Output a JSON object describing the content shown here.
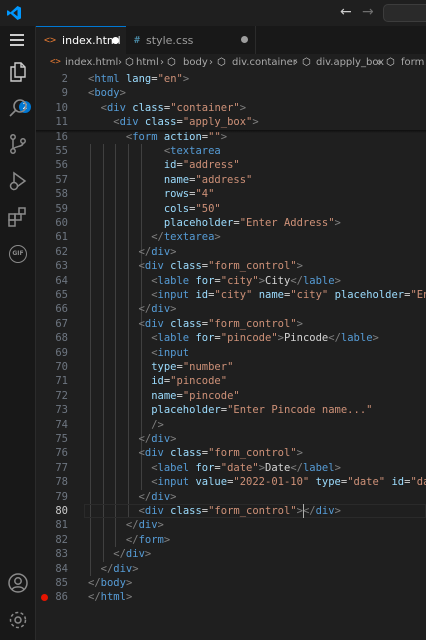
{
  "titlebar": {
    "back_icon": "arrow-left-icon",
    "forward_icon": "arrow-right-icon"
  },
  "activity_bar": {
    "items": [
      {
        "name": "explorer",
        "icon": "files-icon",
        "badge": "2"
      },
      {
        "name": "search",
        "icon": "search-icon"
      },
      {
        "name": "source-control",
        "icon": "source-control-icon"
      },
      {
        "name": "run-debug",
        "icon": "run-debug-icon"
      },
      {
        "name": "extensions",
        "icon": "extensions-icon"
      },
      {
        "name": "gif",
        "icon": "gif-icon",
        "label": "GIF"
      },
      {
        "name": "accounts",
        "icon": "account-icon"
      },
      {
        "name": "manage",
        "icon": "gear-icon"
      }
    ]
  },
  "tabs": [
    {
      "label": "index.html",
      "icon_text": "<>",
      "icon_color": "#e37933",
      "active": true,
      "modified": true
    },
    {
      "label": "style.css",
      "icon_text": "#",
      "icon_color": "#519aba",
      "active": false,
      "modified": true
    }
  ],
  "breadcrumbs": [
    "index.html",
    "html",
    "body",
    "div.container",
    "div.apply_box",
    "form"
  ],
  "colors": {
    "tag": "#569cd6",
    "attribute": "#9cdcfe",
    "string": "#ce9178",
    "punctuation": "#808080",
    "text": "#d4d4d4",
    "accent": "#0078d4",
    "breakpoint": "#e51400"
  },
  "editor": {
    "current_line": 80,
    "breakpoint_line": 86,
    "sticky_lines": [
      {
        "num": "2",
        "indent": 0,
        "code": [
          [
            "p",
            "<"
          ],
          [
            "t",
            "html"
          ],
          [
            "x",
            " "
          ],
          [
            "a",
            "lang"
          ],
          [
            "x",
            "="
          ],
          [
            "s",
            "\"en\""
          ],
          [
            "p",
            ">"
          ]
        ]
      },
      {
        "num": "9",
        "indent": 0,
        "code": [
          [
            "p",
            "<"
          ],
          [
            "t",
            "body"
          ],
          [
            "p",
            ">"
          ]
        ]
      },
      {
        "num": "10",
        "indent": 1,
        "code": [
          [
            "p",
            "<"
          ],
          [
            "t",
            "div"
          ],
          [
            "x",
            " "
          ],
          [
            "a",
            "class"
          ],
          [
            "x",
            "="
          ],
          [
            "s",
            "\"container\""
          ],
          [
            "p",
            ">"
          ]
        ]
      },
      {
        "num": "11",
        "indent": 2,
        "code": [
          [
            "p",
            "<"
          ],
          [
            "t",
            "div"
          ],
          [
            "x",
            " "
          ],
          [
            "a",
            "class"
          ],
          [
            "x",
            "="
          ],
          [
            "s",
            "\"apply_box\""
          ],
          [
            "p",
            ">"
          ]
        ]
      },
      {
        "num": "16",
        "indent": 3,
        "code": [
          [
            "p",
            "<"
          ],
          [
            "t",
            "form"
          ],
          [
            "x",
            " "
          ],
          [
            "a",
            "action"
          ],
          [
            "x",
            "="
          ],
          [
            "s",
            "\"\""
          ],
          [
            "p",
            ">"
          ]
        ]
      }
    ],
    "lines": [
      {
        "num": "55",
        "indent": 6,
        "code": [
          [
            "p",
            "<"
          ],
          [
            "t",
            "textarea"
          ]
        ]
      },
      {
        "num": "56",
        "indent": 6,
        "code": [
          [
            "a",
            "id"
          ],
          [
            "x",
            "="
          ],
          [
            "s",
            "\"address\""
          ]
        ]
      },
      {
        "num": "57",
        "indent": 6,
        "code": [
          [
            "a",
            "name"
          ],
          [
            "x",
            "="
          ],
          [
            "s",
            "\"address\""
          ]
        ]
      },
      {
        "num": "58",
        "indent": 6,
        "code": [
          [
            "a",
            "rows"
          ],
          [
            "x",
            "="
          ],
          [
            "s",
            "\"4\""
          ]
        ]
      },
      {
        "num": "59",
        "indent": 6,
        "code": [
          [
            "a",
            "cols"
          ],
          [
            "x",
            "="
          ],
          [
            "s",
            "\"50\""
          ]
        ]
      },
      {
        "num": "60",
        "indent": 6,
        "code": [
          [
            "a",
            "placeholder"
          ],
          [
            "x",
            "="
          ],
          [
            "s",
            "\"Enter Address\""
          ],
          [
            "p",
            ">"
          ]
        ]
      },
      {
        "num": "61",
        "indent": 5,
        "code": [
          [
            "p",
            "</"
          ],
          [
            "t",
            "textarea"
          ],
          [
            "p",
            ">"
          ]
        ]
      },
      {
        "num": "62",
        "indent": 4,
        "code": [
          [
            "p",
            "</"
          ],
          [
            "t",
            "div"
          ],
          [
            "p",
            ">"
          ]
        ]
      },
      {
        "num": "63",
        "indent": 4,
        "code": [
          [
            "p",
            "<"
          ],
          [
            "t",
            "div"
          ],
          [
            "x",
            " "
          ],
          [
            "a",
            "class"
          ],
          [
            "x",
            "="
          ],
          [
            "s",
            "\"form_control\""
          ],
          [
            "p",
            ">"
          ]
        ]
      },
      {
        "num": "64",
        "indent": 5,
        "code": [
          [
            "p",
            "<"
          ],
          [
            "t",
            "lable"
          ],
          [
            "x",
            " "
          ],
          [
            "a",
            "for"
          ],
          [
            "x",
            "="
          ],
          [
            "s",
            "\"city\""
          ],
          [
            "p",
            ">"
          ],
          [
            "x",
            "City"
          ],
          [
            "p",
            "</"
          ],
          [
            "t",
            "lable"
          ],
          [
            "p",
            ">"
          ]
        ]
      },
      {
        "num": "65",
        "indent": 5,
        "code": [
          [
            "p",
            "<"
          ],
          [
            "t",
            "input"
          ],
          [
            "x",
            " "
          ],
          [
            "a",
            "id"
          ],
          [
            "x",
            "="
          ],
          [
            "s",
            "\"city\""
          ],
          [
            "x",
            " "
          ],
          [
            "a",
            "name"
          ],
          [
            "x",
            "="
          ],
          [
            "s",
            "\"city\""
          ],
          [
            "x",
            " "
          ],
          [
            "a",
            "placeholder"
          ],
          [
            "x",
            "="
          ],
          [
            "s",
            "\"Ente"
          ]
        ]
      },
      {
        "num": "66",
        "indent": 4,
        "code": [
          [
            "p",
            "</"
          ],
          [
            "t",
            "div"
          ],
          [
            "p",
            ">"
          ]
        ]
      },
      {
        "num": "67",
        "indent": 4,
        "code": [
          [
            "p",
            "<"
          ],
          [
            "t",
            "div"
          ],
          [
            "x",
            " "
          ],
          [
            "a",
            "class"
          ],
          [
            "x",
            "="
          ],
          [
            "s",
            "\"form_control\""
          ],
          [
            "p",
            ">"
          ]
        ]
      },
      {
        "num": "68",
        "indent": 5,
        "code": [
          [
            "p",
            "<"
          ],
          [
            "t",
            "lable"
          ],
          [
            "x",
            " "
          ],
          [
            "a",
            "for"
          ],
          [
            "x",
            "="
          ],
          [
            "s",
            "\"pincode\""
          ],
          [
            "p",
            ">"
          ],
          [
            "x",
            "Pincode"
          ],
          [
            "p",
            "</"
          ],
          [
            "t",
            "lable"
          ],
          [
            "p",
            ">"
          ]
        ]
      },
      {
        "num": "69",
        "indent": 5,
        "code": [
          [
            "p",
            "<"
          ],
          [
            "t",
            "input"
          ]
        ]
      },
      {
        "num": "70",
        "indent": 5,
        "code": [
          [
            "a",
            "type"
          ],
          [
            "x",
            "="
          ],
          [
            "s",
            "\"number\""
          ]
        ]
      },
      {
        "num": "71",
        "indent": 5,
        "code": [
          [
            "a",
            "id"
          ],
          [
            "x",
            "="
          ],
          [
            "s",
            "\"pincode\""
          ]
        ]
      },
      {
        "num": "72",
        "indent": 5,
        "code": [
          [
            "a",
            "name"
          ],
          [
            "x",
            "="
          ],
          [
            "s",
            "\"pincode\""
          ]
        ]
      },
      {
        "num": "73",
        "indent": 5,
        "code": [
          [
            "a",
            "placeholder"
          ],
          [
            "x",
            "="
          ],
          [
            "s",
            "\"Enter Pincode name...\""
          ]
        ]
      },
      {
        "num": "74",
        "indent": 5,
        "code": [
          [
            "p",
            "/>"
          ]
        ]
      },
      {
        "num": "75",
        "indent": 4,
        "code": [
          [
            "p",
            "</"
          ],
          [
            "t",
            "div"
          ],
          [
            "p",
            ">"
          ]
        ]
      },
      {
        "num": "76",
        "indent": 4,
        "code": [
          [
            "p",
            "<"
          ],
          [
            "t",
            "div"
          ],
          [
            "x",
            " "
          ],
          [
            "a",
            "class"
          ],
          [
            "x",
            "="
          ],
          [
            "s",
            "\"form_control\""
          ],
          [
            "p",
            ">"
          ]
        ]
      },
      {
        "num": "77",
        "indent": 5,
        "code": [
          [
            "p",
            "<"
          ],
          [
            "t",
            "label"
          ],
          [
            "x",
            " "
          ],
          [
            "a",
            "for"
          ],
          [
            "x",
            "="
          ],
          [
            "s",
            "\"date\""
          ],
          [
            "p",
            ">"
          ],
          [
            "x",
            "Date"
          ],
          [
            "p",
            "</"
          ],
          [
            "t",
            "label"
          ],
          [
            "p",
            ">"
          ]
        ]
      },
      {
        "num": "78",
        "indent": 5,
        "code": [
          [
            "p",
            "<"
          ],
          [
            "t",
            "input"
          ],
          [
            "x",
            " "
          ],
          [
            "a",
            "value"
          ],
          [
            "x",
            "="
          ],
          [
            "s",
            "\"2022-01-10\""
          ],
          [
            "x",
            " "
          ],
          [
            "a",
            "type"
          ],
          [
            "x",
            "="
          ],
          [
            "s",
            "\"date\""
          ],
          [
            "x",
            " "
          ],
          [
            "a",
            "id"
          ],
          [
            "x",
            "="
          ],
          [
            "s",
            "\"date"
          ]
        ]
      },
      {
        "num": "79",
        "indent": 4,
        "code": [
          [
            "p",
            "</"
          ],
          [
            "t",
            "div"
          ],
          [
            "p",
            ">"
          ]
        ]
      },
      {
        "num": "80",
        "indent": 4,
        "code": [
          [
            "p",
            "<"
          ],
          [
            "t",
            "div"
          ],
          [
            "x",
            " "
          ],
          [
            "a",
            "class"
          ],
          [
            "x",
            "="
          ],
          [
            "s",
            "\"form_control\""
          ],
          [
            "p",
            ">"
          ],
          [
            "p",
            "</"
          ],
          [
            "t",
            "div"
          ],
          [
            "p",
            ">"
          ]
        ]
      },
      {
        "num": "81",
        "indent": 3,
        "code": [
          [
            "p",
            "</"
          ],
          [
            "t",
            "div"
          ],
          [
            "p",
            ">"
          ]
        ]
      },
      {
        "num": "82",
        "indent": 3,
        "code": [
          [
            "p",
            "</"
          ],
          [
            "t",
            "form"
          ],
          [
            "p",
            ">"
          ]
        ]
      },
      {
        "num": "83",
        "indent": 2,
        "code": [
          [
            "p",
            "</"
          ],
          [
            "t",
            "div"
          ],
          [
            "p",
            ">"
          ]
        ]
      },
      {
        "num": "84",
        "indent": 1,
        "code": [
          [
            "p",
            "</"
          ],
          [
            "t",
            "div"
          ],
          [
            "p",
            ">"
          ]
        ]
      },
      {
        "num": "85",
        "indent": 0,
        "code": [
          [
            "p",
            "</"
          ],
          [
            "t",
            "body"
          ],
          [
            "p",
            ">"
          ]
        ]
      },
      {
        "num": "86",
        "indent": 0,
        "code": [
          [
            "p",
            "</"
          ],
          [
            "t",
            "html"
          ],
          [
            "p",
            ">"
          ]
        ]
      }
    ]
  }
}
